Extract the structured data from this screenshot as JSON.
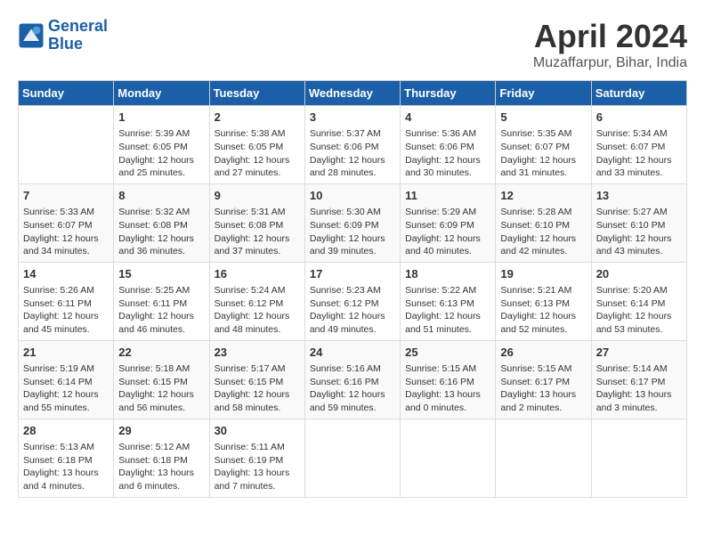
{
  "header": {
    "logo_line1": "General",
    "logo_line2": "Blue",
    "month_title": "April 2024",
    "location": "Muzaffarpur, Bihar, India"
  },
  "days_of_week": [
    "Sunday",
    "Monday",
    "Tuesday",
    "Wednesday",
    "Thursday",
    "Friday",
    "Saturday"
  ],
  "weeks": [
    [
      {
        "day": "",
        "info": ""
      },
      {
        "day": "1",
        "info": "Sunrise: 5:39 AM\nSunset: 6:05 PM\nDaylight: 12 hours\nand 25 minutes."
      },
      {
        "day": "2",
        "info": "Sunrise: 5:38 AM\nSunset: 6:05 PM\nDaylight: 12 hours\nand 27 minutes."
      },
      {
        "day": "3",
        "info": "Sunrise: 5:37 AM\nSunset: 6:06 PM\nDaylight: 12 hours\nand 28 minutes."
      },
      {
        "day": "4",
        "info": "Sunrise: 5:36 AM\nSunset: 6:06 PM\nDaylight: 12 hours\nand 30 minutes."
      },
      {
        "day": "5",
        "info": "Sunrise: 5:35 AM\nSunset: 6:07 PM\nDaylight: 12 hours\nand 31 minutes."
      },
      {
        "day": "6",
        "info": "Sunrise: 5:34 AM\nSunset: 6:07 PM\nDaylight: 12 hours\nand 33 minutes."
      }
    ],
    [
      {
        "day": "7",
        "info": "Sunrise: 5:33 AM\nSunset: 6:07 PM\nDaylight: 12 hours\nand 34 minutes."
      },
      {
        "day": "8",
        "info": "Sunrise: 5:32 AM\nSunset: 6:08 PM\nDaylight: 12 hours\nand 36 minutes."
      },
      {
        "day": "9",
        "info": "Sunrise: 5:31 AM\nSunset: 6:08 PM\nDaylight: 12 hours\nand 37 minutes."
      },
      {
        "day": "10",
        "info": "Sunrise: 5:30 AM\nSunset: 6:09 PM\nDaylight: 12 hours\nand 39 minutes."
      },
      {
        "day": "11",
        "info": "Sunrise: 5:29 AM\nSunset: 6:09 PM\nDaylight: 12 hours\nand 40 minutes."
      },
      {
        "day": "12",
        "info": "Sunrise: 5:28 AM\nSunset: 6:10 PM\nDaylight: 12 hours\nand 42 minutes."
      },
      {
        "day": "13",
        "info": "Sunrise: 5:27 AM\nSunset: 6:10 PM\nDaylight: 12 hours\nand 43 minutes."
      }
    ],
    [
      {
        "day": "14",
        "info": "Sunrise: 5:26 AM\nSunset: 6:11 PM\nDaylight: 12 hours\nand 45 minutes."
      },
      {
        "day": "15",
        "info": "Sunrise: 5:25 AM\nSunset: 6:11 PM\nDaylight: 12 hours\nand 46 minutes."
      },
      {
        "day": "16",
        "info": "Sunrise: 5:24 AM\nSunset: 6:12 PM\nDaylight: 12 hours\nand 48 minutes."
      },
      {
        "day": "17",
        "info": "Sunrise: 5:23 AM\nSunset: 6:12 PM\nDaylight: 12 hours\nand 49 minutes."
      },
      {
        "day": "18",
        "info": "Sunrise: 5:22 AM\nSunset: 6:13 PM\nDaylight: 12 hours\nand 51 minutes."
      },
      {
        "day": "19",
        "info": "Sunrise: 5:21 AM\nSunset: 6:13 PM\nDaylight: 12 hours\nand 52 minutes."
      },
      {
        "day": "20",
        "info": "Sunrise: 5:20 AM\nSunset: 6:14 PM\nDaylight: 12 hours\nand 53 minutes."
      }
    ],
    [
      {
        "day": "21",
        "info": "Sunrise: 5:19 AM\nSunset: 6:14 PM\nDaylight: 12 hours\nand 55 minutes."
      },
      {
        "day": "22",
        "info": "Sunrise: 5:18 AM\nSunset: 6:15 PM\nDaylight: 12 hours\nand 56 minutes."
      },
      {
        "day": "23",
        "info": "Sunrise: 5:17 AM\nSunset: 6:15 PM\nDaylight: 12 hours\nand 58 minutes."
      },
      {
        "day": "24",
        "info": "Sunrise: 5:16 AM\nSunset: 6:16 PM\nDaylight: 12 hours\nand 59 minutes."
      },
      {
        "day": "25",
        "info": "Sunrise: 5:15 AM\nSunset: 6:16 PM\nDaylight: 13 hours\nand 0 minutes."
      },
      {
        "day": "26",
        "info": "Sunrise: 5:15 AM\nSunset: 6:17 PM\nDaylight: 13 hours\nand 2 minutes."
      },
      {
        "day": "27",
        "info": "Sunrise: 5:14 AM\nSunset: 6:17 PM\nDaylight: 13 hours\nand 3 minutes."
      }
    ],
    [
      {
        "day": "28",
        "info": "Sunrise: 5:13 AM\nSunset: 6:18 PM\nDaylight: 13 hours\nand 4 minutes."
      },
      {
        "day": "29",
        "info": "Sunrise: 5:12 AM\nSunset: 6:18 PM\nDaylight: 13 hours\nand 6 minutes."
      },
      {
        "day": "30",
        "info": "Sunrise: 5:11 AM\nSunset: 6:19 PM\nDaylight: 13 hours\nand 7 minutes."
      },
      {
        "day": "",
        "info": ""
      },
      {
        "day": "",
        "info": ""
      },
      {
        "day": "",
        "info": ""
      },
      {
        "day": "",
        "info": ""
      }
    ]
  ]
}
